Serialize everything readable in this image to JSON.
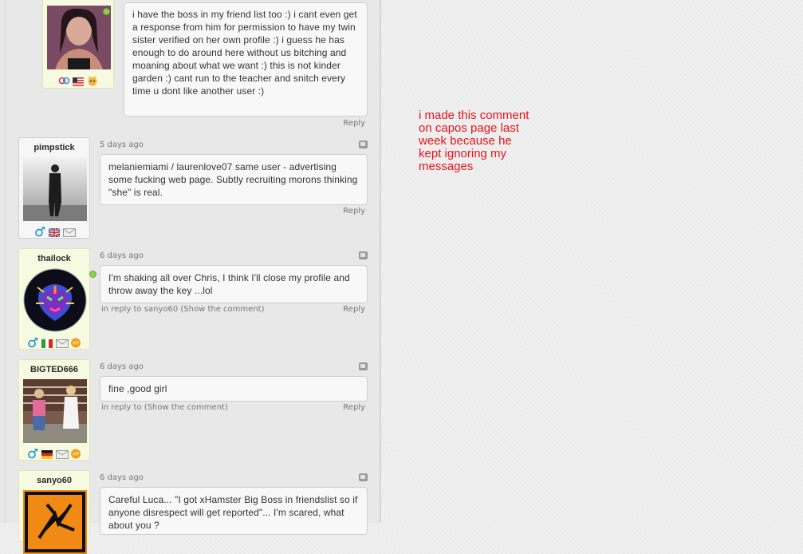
{
  "comments": [
    {
      "username": "",
      "text": "i have the boss in my friend list too :) i cant even get a response from him for permission to have my twin sister verified on her own profile :) i guess he has enough to do around here without us bitching and moaning about what we want :) this is not kinder garden :) cant run to the teacher and snitch every time u dont like another user :)",
      "reply_label": "Reply"
    },
    {
      "username": "pimpstick",
      "time": "5 days ago",
      "text": "melaniemiami / laurenlove07 same user - advertising some fucking web page. Subtly recruiting morons thinking \"she\" is real.",
      "reply_label": "Reply"
    },
    {
      "username": "thailock",
      "time": "6 days ago",
      "text": "I'm shaking all over Chris, I think I'll close my profile and throw away the key ...lol",
      "in_reply_prefix": "in reply to sanyo60",
      "show_comment": "(Show the comment)",
      "reply_label": "Reply"
    },
    {
      "username": "BIGTED666",
      "time": "6 days ago",
      "text": "fine ,good girl",
      "in_reply_prefix": "in reply to",
      "show_comment": "(Show the comment)",
      "reply_label": "Reply"
    },
    {
      "username": "sanyo60",
      "time": "6 days ago",
      "text": "Careful Luca... \"I got xHamster Big Boss in friendslist so if anyone disrespect will get reported\"... I'm scared, what about you ?"
    }
  ],
  "annotation": "i made this comment on capos page last week because he kept ignoring my messages",
  "colors": {
    "annotation": "#e8141b",
    "highlight_card": "#f6fae0",
    "online_dot": "#8fd14f",
    "page_bg": "#f0f0f0"
  },
  "icons": {
    "comment1": [
      "couple-gender-icon",
      "us-flag-icon",
      "cat-emoticon-icon"
    ],
    "pimpstick": [
      "male-icon",
      "uk-flag-icon",
      "mail-icon"
    ],
    "thailock": [
      "male-icon",
      "italy-flag-icon",
      "mail-icon",
      "vip-badge-icon"
    ],
    "bigted666": [
      "male-icon",
      "germany-flag-icon",
      "mail-icon",
      "vip-badge-icon"
    ]
  }
}
